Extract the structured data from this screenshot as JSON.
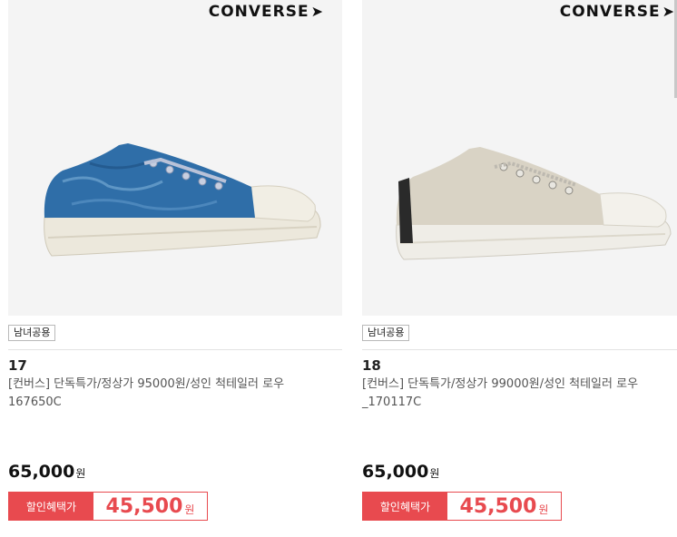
{
  "brand_logo": "CONVERSE",
  "products": [
    {
      "tag": "남녀공용",
      "number": "17",
      "title": "[컨버스] 단독특가/정상가 95000원/성인 척테일러 로우 167650C",
      "price": "65,000",
      "price_unit": "원",
      "sale_label": "할인혜택가",
      "sale_price": "45,500",
      "sale_unit": "원",
      "shoe_color": "#2f6ea8"
    },
    {
      "tag": "남녀공용",
      "number": "18",
      "title": "[컨버스] 단독특가/정상가 99000원/성인 척테일러 로우_170117C",
      "price": "65,000",
      "price_unit": "원",
      "sale_label": "할인혜택가",
      "sale_price": "45,500",
      "sale_unit": "원",
      "shoe_color": "#d9d3c5"
    }
  ],
  "colors": {
    "accent": "#e84a4f"
  }
}
